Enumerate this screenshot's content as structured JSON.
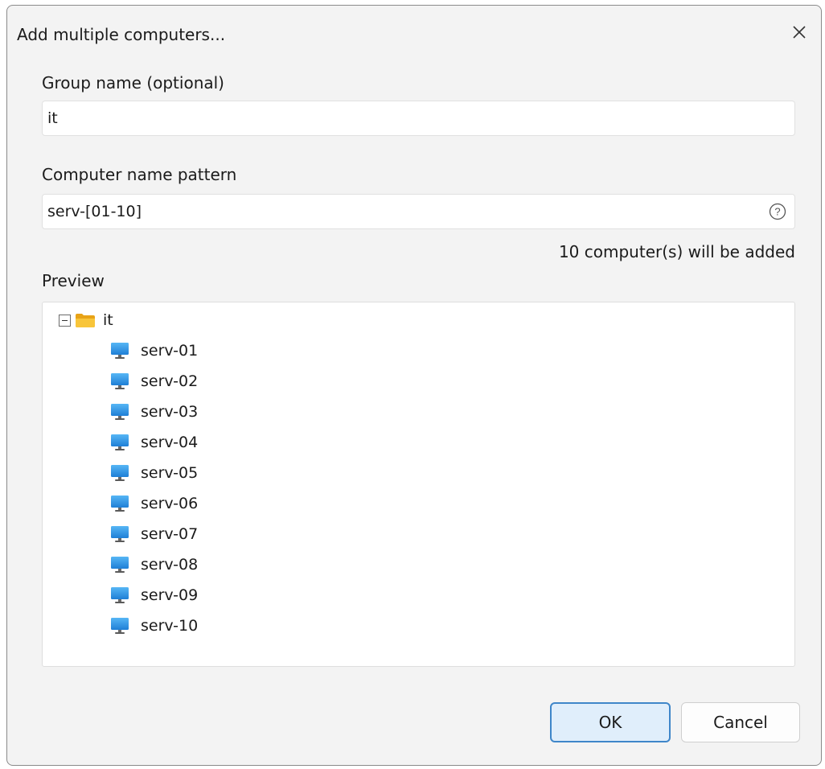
{
  "dialog": {
    "title": "Add multiple computers..."
  },
  "group": {
    "label": "Group name (optional)",
    "value": "it"
  },
  "pattern": {
    "label": "Computer name pattern",
    "value": "serv-[01-10]"
  },
  "count_text": "10 computer(s) will be added",
  "preview": {
    "label": "Preview",
    "group_name": "it",
    "computers": [
      "serv-01",
      "serv-02",
      "serv-03",
      "serv-04",
      "serv-05",
      "serv-06",
      "serv-07",
      "serv-08",
      "serv-09",
      "serv-10"
    ]
  },
  "buttons": {
    "ok": "OK",
    "cancel": "Cancel"
  },
  "icons": {
    "close": "close-icon",
    "help": "help-icon",
    "folder": "folder-icon",
    "computer": "computer-icon",
    "collapse": "collapse-icon"
  },
  "colors": {
    "accent": "#3f86c9",
    "folder": "#f4b400",
    "computer": "#2a8ee0"
  }
}
